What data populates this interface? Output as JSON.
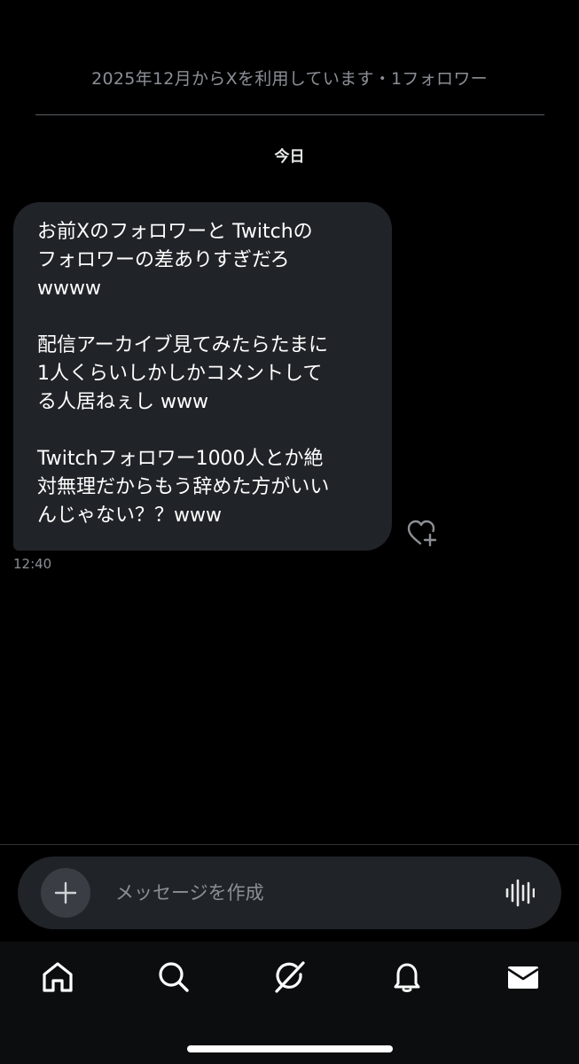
{
  "header": {
    "account_info": "2025年12月からXを利用しています・1フォロワー"
  },
  "conversation": {
    "date_separator": "今日",
    "messages": [
      {
        "paragraphs": [
          "お前Xのフォロワーと Twitchの\nフォロワーの差ありすぎだろ\nwwww",
          "配信アーカイブ見てみたらたまに\n1人くらいしかしかコメントして\nる人居ねぇし www",
          "Twitchフォロワー1000人とか絶\n対無理だからもう辞めた方がいい\nんじゃない？？www"
        ],
        "time": "12:40"
      }
    ]
  },
  "composer": {
    "placeholder": "メッセージを作成",
    "add_icon": "plus-icon",
    "voice_icon": "audio-waveform-icon"
  },
  "nav": {
    "items": [
      "home-icon",
      "search-icon",
      "grok-icon",
      "notifications-bell-icon",
      "messages-envelope-icon"
    ]
  },
  "colors": {
    "background": "#000000",
    "bubble": "#202327",
    "muted_text": "#8b8f95",
    "primary_text": "#ffffff"
  }
}
